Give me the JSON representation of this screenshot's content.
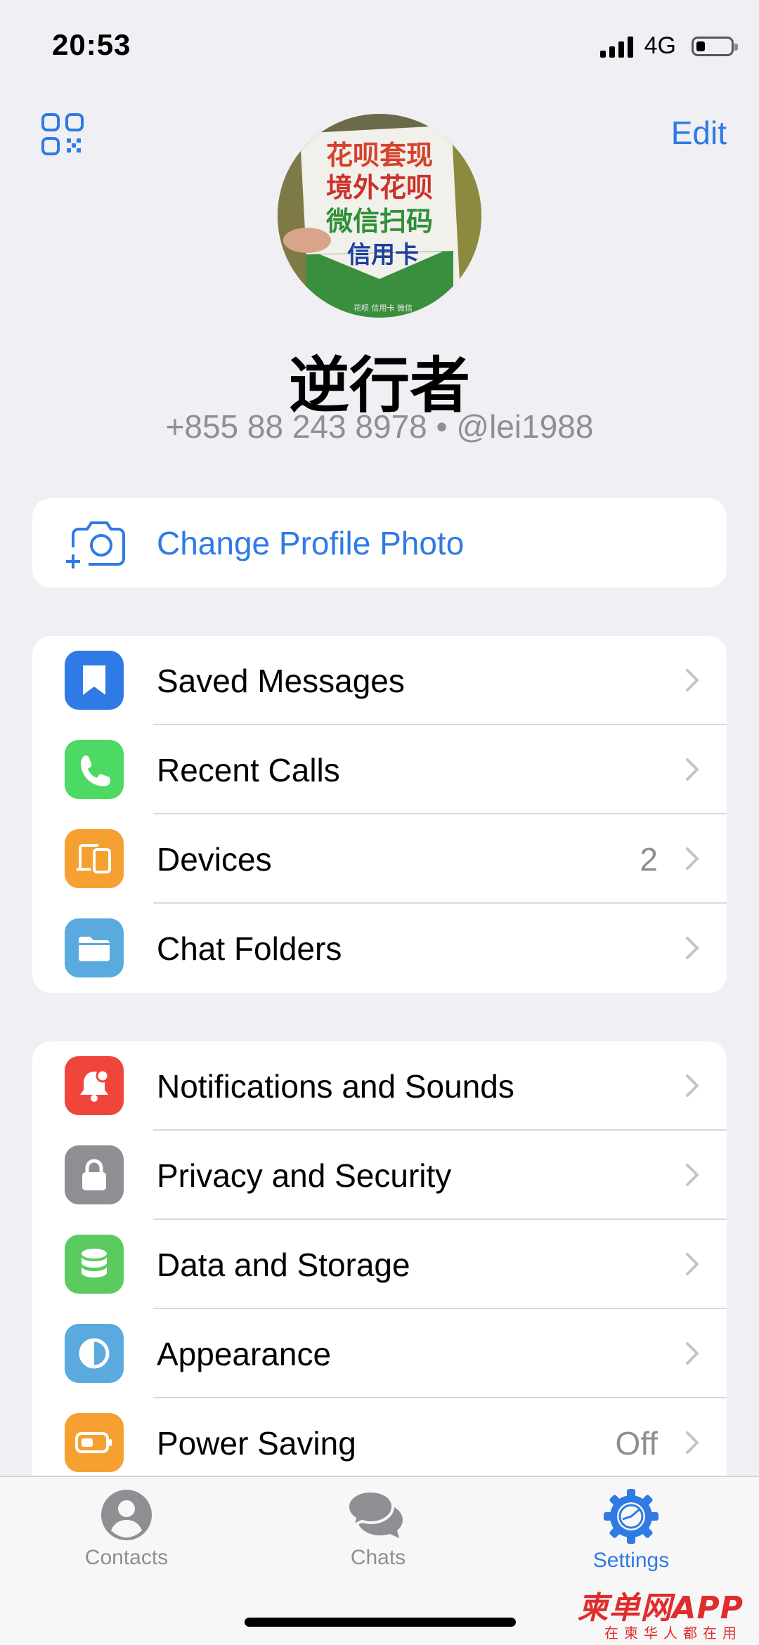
{
  "status_bar": {
    "time": "20:53",
    "network": "4G"
  },
  "header": {
    "edit_label": "Edit",
    "qr_icon": "qr-code-icon"
  },
  "profile": {
    "name": "逆行者",
    "phone_username": "+855 88 243 8978 • @lei1988",
    "avatar_sign_lines": [
      "花呗套现",
      "境外花呗",
      "微信扫码",
      "信用卡"
    ],
    "avatar_small_text": "花呗 信用卡 微信"
  },
  "change_photo": {
    "label": "Change Profile Photo",
    "icon": "add-photo-camera-icon"
  },
  "section1": {
    "items": [
      {
        "label": "Saved Messages",
        "icon": "bookmark-icon",
        "color": "#2f7ae5",
        "value": ""
      },
      {
        "label": "Recent Calls",
        "icon": "phone-icon",
        "color": "#4cd964",
        "value": ""
      },
      {
        "label": "Devices",
        "icon": "devices-icon",
        "color": "#f5a030",
        "value": "2"
      },
      {
        "label": "Chat Folders",
        "icon": "folder-icon",
        "color": "#5aaae0",
        "value": ""
      }
    ]
  },
  "section2": {
    "items": [
      {
        "label": "Notifications and Sounds",
        "icon": "bell-icon",
        "color": "#f0453a",
        "value": ""
      },
      {
        "label": "Privacy and Security",
        "icon": "lock-icon",
        "color": "#8e8e93",
        "value": ""
      },
      {
        "label": "Data and Storage",
        "icon": "database-icon",
        "color": "#5ccb5f",
        "value": ""
      },
      {
        "label": "Appearance",
        "icon": "half-circle-icon",
        "color": "#5aaae0",
        "value": ""
      },
      {
        "label": "Power Saving",
        "icon": "battery-icon",
        "color": "#f5a030",
        "value": "Off"
      }
    ]
  },
  "tabbar": {
    "tabs": [
      {
        "label": "Contacts",
        "icon": "person-icon",
        "active": false
      },
      {
        "label": "Chats",
        "icon": "chat-bubbles-icon",
        "active": false
      },
      {
        "label": "Settings",
        "icon": "gear-icon",
        "active": true
      }
    ]
  },
  "watermark": {
    "main": "柬单网APP",
    "sub": "在柬华人都在用"
  },
  "colors": {
    "accent": "#2f7ae5",
    "background": "#efeff4",
    "secondary_text": "#8e8e93"
  }
}
